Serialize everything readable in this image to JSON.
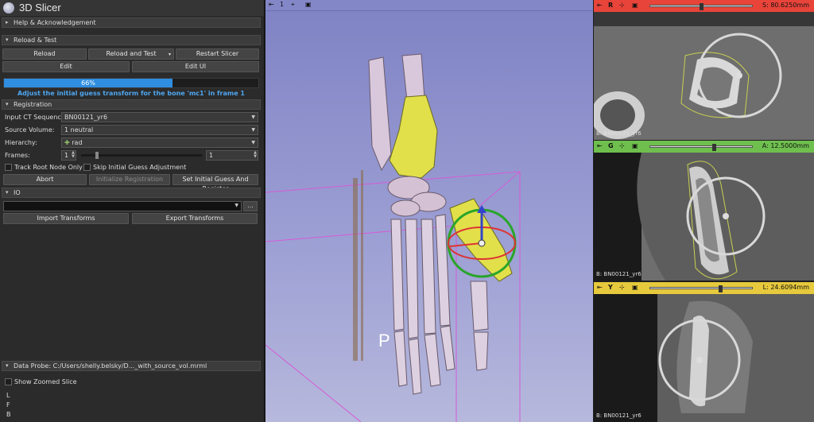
{
  "app": {
    "title": "3D Slicer"
  },
  "sections": {
    "help": "Help & Acknowledgement",
    "reload": "Reload & Test",
    "registration": "Registration",
    "io": "IO",
    "data_probe": "Data Probe: C:/Users/shelly.belsky/D..._with_source_vol.mrml"
  },
  "reload_buttons": {
    "reload": "Reload",
    "reload_and_test": "Reload and Test",
    "restart": "Restart Slicer",
    "edit": "Edit",
    "edit_ui": "Edit UI"
  },
  "progress": {
    "text": "66%",
    "fraction": 0.66
  },
  "status_message": "Adjust the initial guess transform for the bone 'mc1' in frame 1",
  "registration": {
    "input_ct_label": "Input CT Sequence:",
    "input_ct_value": "BN00121_yr6",
    "source_volume_label": "Source Volume:",
    "source_volume_value": "1 neutral",
    "hierarchy_label": "Hierarchy:",
    "hierarchy_value": "rad",
    "frames_label": "Frames:",
    "frames_start": "1",
    "frames_end": "1",
    "track_root_label": "Track Root Node Only",
    "skip_initial_label": "Skip Initial Guess Adjustment",
    "abort": "Abort",
    "initialize": "Initialize Registration",
    "set_initial": "Set Initial Guess And Register"
  },
  "io": {
    "dots": "...",
    "import": "Import Transforms",
    "export": "Export Transforms"
  },
  "data_probe": {
    "show_zoomed": "Show Zoomed Slice",
    "lines": [
      "L",
      "F",
      "B"
    ]
  },
  "view3d": {
    "layout_number": "1",
    "orientation_label": "P"
  },
  "slices": [
    {
      "id": "red",
      "letter": "R",
      "value": "S: 80.6250mm",
      "color": "#e8443a",
      "volume": "B: BN00121_yr6"
    },
    {
      "id": "green",
      "letter": "G",
      "value": "A: 12.5000mm",
      "color": "#6fbf4e",
      "volume": "B: BN00121_yr6"
    },
    {
      "id": "yellow",
      "letter": "Y",
      "value": "L: 24.6094mm",
      "color": "#e6c93c",
      "volume": "B: BN00121_yr6"
    }
  ]
}
